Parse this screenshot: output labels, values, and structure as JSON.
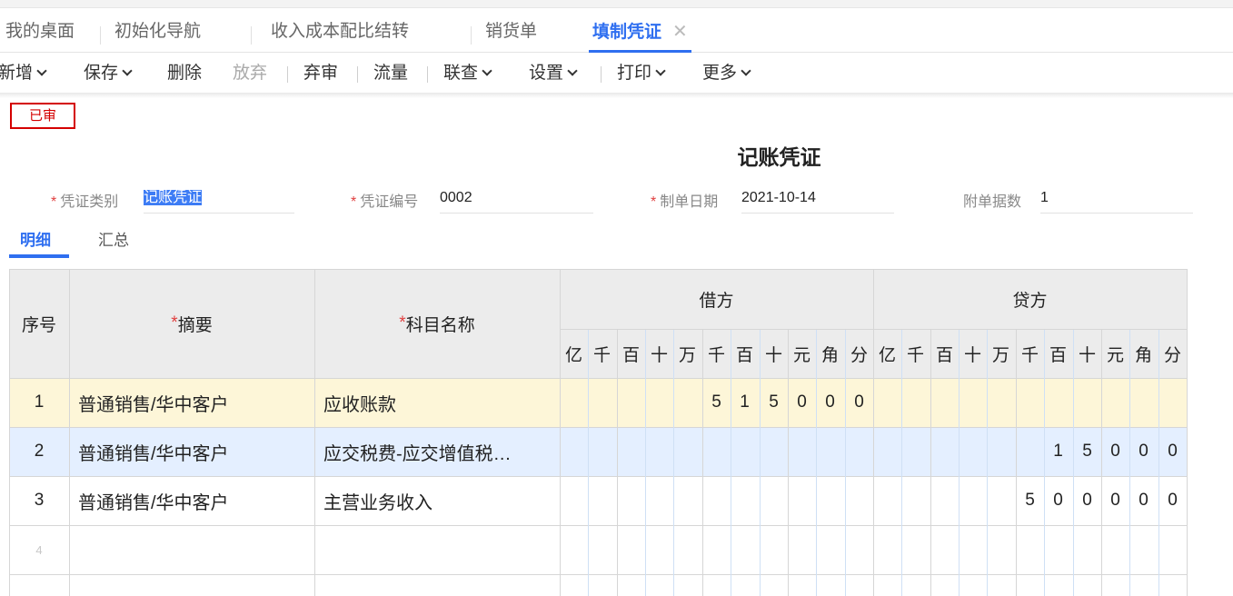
{
  "tabs": [
    {
      "label": "我的桌面",
      "active": false
    },
    {
      "label": "初始化导航",
      "active": false
    },
    {
      "label": "收入成本配比结转",
      "active": false
    },
    {
      "label": "销货单",
      "active": false
    },
    {
      "label": "填制凭证",
      "active": true
    }
  ],
  "tab_close_glyph": "✕",
  "toolbar": {
    "add": "新增",
    "save": "保存",
    "delete": "删除",
    "discard": "放弃",
    "unaudit": "弃审",
    "flow": "流量",
    "link": "联查",
    "settings": "设置",
    "print": "打印",
    "more": "更多"
  },
  "stamp": "已审",
  "voucher": {
    "title": "记账凭证",
    "type_label": "凭证类别",
    "type_value": "记账凭证",
    "number_label": "凭证编号",
    "number_value": "0002",
    "date_label": "制单日期",
    "date_value": "2021-10-14",
    "attach_label": "附单据数",
    "attach_value": "1"
  },
  "subtabs": {
    "detail": "明细",
    "summary": "汇总"
  },
  "table": {
    "col_seq": "序号",
    "col_summary": "摘要",
    "col_account": "科目名称",
    "col_debit": "借方",
    "col_credit": "贷方",
    "required_mark": "*",
    "units": [
      "亿",
      "千",
      "百",
      "十",
      "万",
      "千",
      "百",
      "十",
      "元",
      "角",
      "分"
    ],
    "rows": [
      {
        "seq": "1",
        "summary": "普通销售/华中客户",
        "account": "应收账款",
        "debit_digits": [
          "",
          "",
          "",
          "",
          "",
          "5",
          "1",
          "5",
          "0",
          "0",
          "0"
        ],
        "credit_digits": [
          "",
          "",
          "",
          "",
          "",
          "",
          "",
          "",
          "",
          "",
          ""
        ],
        "bg": "#fdf6d8"
      },
      {
        "seq": "2",
        "summary": "普通销售/华中客户",
        "account": "应交税费-应交增值税…",
        "debit_digits": [
          "",
          "",
          "",
          "",
          "",
          "",
          "",
          "",
          "",
          "",
          ""
        ],
        "credit_digits": [
          "",
          "",
          "",
          "",
          "",
          "",
          "1",
          "5",
          "0",
          "0",
          "0"
        ],
        "bg": "#e4efff"
      },
      {
        "seq": "3",
        "summary": "普通销售/华中客户",
        "account": "主营业务收入",
        "debit_digits": [
          "",
          "",
          "",
          "",
          "",
          "",
          "",
          "",
          "",
          "",
          ""
        ],
        "credit_digits": [
          "",
          "",
          "",
          "",
          "",
          "5",
          "0",
          "0",
          "0",
          "0",
          "0"
        ],
        "bg": "#ffffff"
      },
      {
        "seq": "4",
        "summary": "",
        "account": "",
        "debit_digits": [
          "",
          "",
          "",
          "",
          "",
          "",
          "",
          "",
          "",
          "",
          ""
        ],
        "credit_digits": [
          "",
          "",
          "",
          "",
          "",
          "",
          "",
          "",
          "",
          "",
          ""
        ],
        "bg": "#ffffff"
      }
    ]
  }
}
